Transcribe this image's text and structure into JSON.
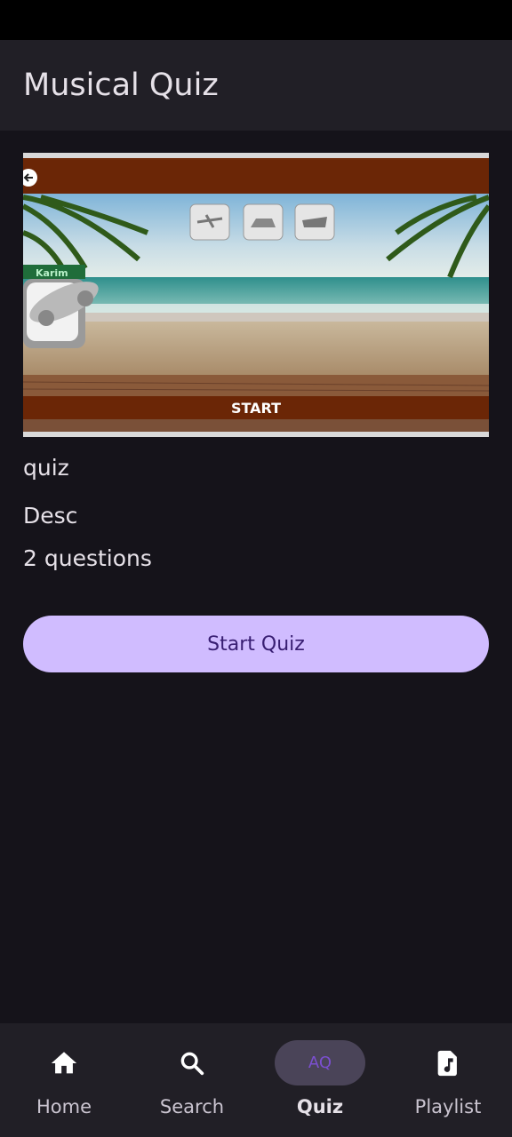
{
  "app_bar": {
    "title": "Musical Quiz"
  },
  "thumbnail": {
    "player_name": "Karim",
    "start_label": "START"
  },
  "quiz": {
    "title": "quiz",
    "description": "Desc",
    "question_count": "2 questions"
  },
  "start_button": {
    "label": "Start Quiz"
  },
  "bottom_nav": {
    "items": [
      {
        "label": "Home",
        "icon": "home-icon",
        "active": false
      },
      {
        "label": "Search",
        "icon": "search-icon",
        "active": false
      },
      {
        "label": "Quiz",
        "icon_text": "AQ",
        "active": true
      },
      {
        "label": "Playlist",
        "icon": "music-file-icon",
        "active": false
      }
    ]
  },
  "colors": {
    "background": "#15131a",
    "surface": "#211f26",
    "primary_container": "#d0bcff",
    "on_primary": "#381e72",
    "nav_indicator": "#4a4458"
  }
}
